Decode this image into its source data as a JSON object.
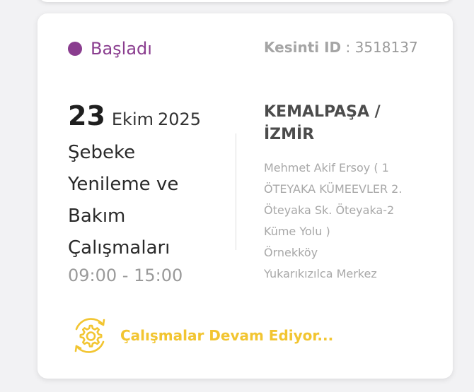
{
  "card": {
    "status_label": "Başladı",
    "outage_id_label": "Kesinti ID",
    "outage_id_separator": " : ",
    "outage_id_value": "3518137",
    "date_day": "23",
    "date_month": "Ekim",
    "date_year": "2025",
    "work_title_lines": [
      "Şebeke",
      "Yenileme ve",
      "Bakım",
      "Çalışmaları"
    ],
    "time_range": "09:00 - 15:00",
    "district_lines": [
      "KEMALPAŞA /",
      "İZMİR"
    ],
    "address_lines": [
      "Mehmet Akif Ersoy ( 1",
      "ÖTEYAKA KÜMEEVLER 2.",
      "Öteyaka Sk. Öteyaka-2",
      "Küme Yolu )",
      "Örnekköy",
      "Yukarıkızılca Merkez"
    ],
    "progress_label": "Çalışmalar Devam Ediyor...",
    "progress_icon": "gear-sync-icon"
  },
  "colors": {
    "status": "#8a3d8f",
    "progress": "#f2c531"
  }
}
